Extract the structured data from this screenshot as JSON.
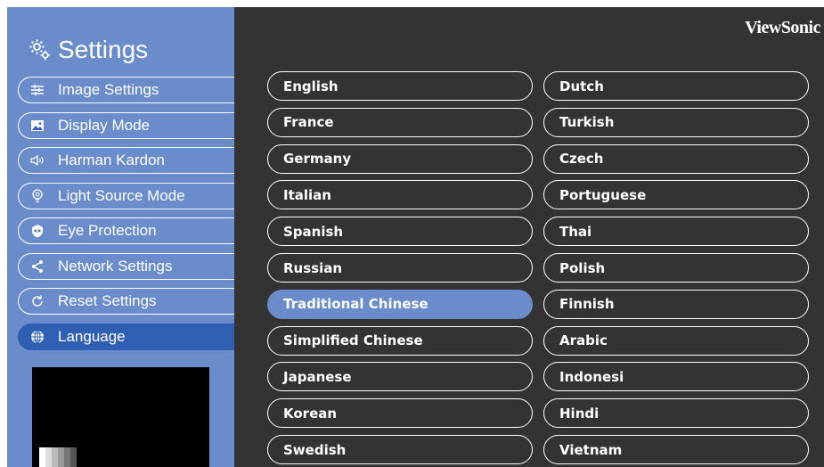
{
  "header": {
    "title": "Settings",
    "brand": "ViewSonic"
  },
  "sidebar": {
    "items": [
      {
        "label": "Image Settings",
        "icon": "sliders-icon"
      },
      {
        "label": "Display Mode",
        "icon": "image-icon"
      },
      {
        "label": "Harman Kardon",
        "icon": "speaker-icon"
      },
      {
        "label": "Light Source Mode",
        "icon": "bulb-icon"
      },
      {
        "label": "Eye Protection",
        "icon": "eye-icon"
      },
      {
        "label": "Network Settings",
        "icon": "share-icon"
      },
      {
        "label": "Reset Settings",
        "icon": "reset-icon"
      },
      {
        "label": "Language",
        "icon": "globe-icon",
        "active": true
      }
    ]
  },
  "languages": {
    "left": [
      "English",
      "France",
      "Germany",
      "Italian",
      "Spanish",
      "Russian",
      "Traditional Chinese",
      "Simplified Chinese",
      "Japanese",
      "Korean",
      "Swedish"
    ],
    "right": [
      "Dutch",
      "Turkish",
      "Czech",
      "Portuguese",
      "Thai",
      "Polish",
      "Finnish",
      "Arabic",
      "Indonesi",
      "Hindi",
      "Vietnam"
    ],
    "selected": "Traditional Chinese"
  },
  "colors": {
    "sidebar": "#6a8ccb",
    "active": "#2f5fb3",
    "main_bg": "#333333",
    "selected": "#6a8ccb"
  }
}
